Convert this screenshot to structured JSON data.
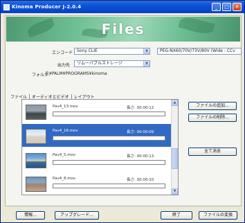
{
  "window": {
    "title": "Kinoma Producer J-2.0.4",
    "min_icon": "minimize-icon",
    "max_icon": "maximize-icon",
    "close_icon": "close-icon"
  },
  "banner": {
    "title": "Files"
  },
  "settings": {
    "encode_label": "エンコード",
    "encode_value": "Sony CLIE",
    "device_value": "PEG-NX60/70V/73V/80V (Wide - CCv",
    "output_label": "出力先",
    "output_value": "リムーバブルストレージ",
    "folder_label": "フォルダ:",
    "folder_path": "F:¥PALM¥PROGRAMS¥kinoma"
  },
  "tabs": [
    "ファイル",
    "オーディオとビデオ",
    "レイアウト"
  ],
  "files": [
    {
      "name": "Pav4_13.mov",
      "duration_label": "長さ: 00:00:12",
      "selected": false
    },
    {
      "name": "Pav4_16.mov",
      "duration_label": "長さ: 00:00:09",
      "selected": true
    },
    {
      "name": "Pav4_5.mov",
      "duration_label": "長さ: 00:00:13",
      "selected": false
    },
    {
      "name": "Pav4_8.mov",
      "duration_label": "長さ: 00:00:10",
      "selected": false
    }
  ],
  "side_buttons": {
    "add": "ファイルの追加...",
    "remove": "ファイルの削除...",
    "select_all": "全て消去"
  },
  "footer": {
    "info": "情報...",
    "upgrade": "アップグレード...",
    "exit": "終了",
    "convert": "ファイルの変換"
  }
}
